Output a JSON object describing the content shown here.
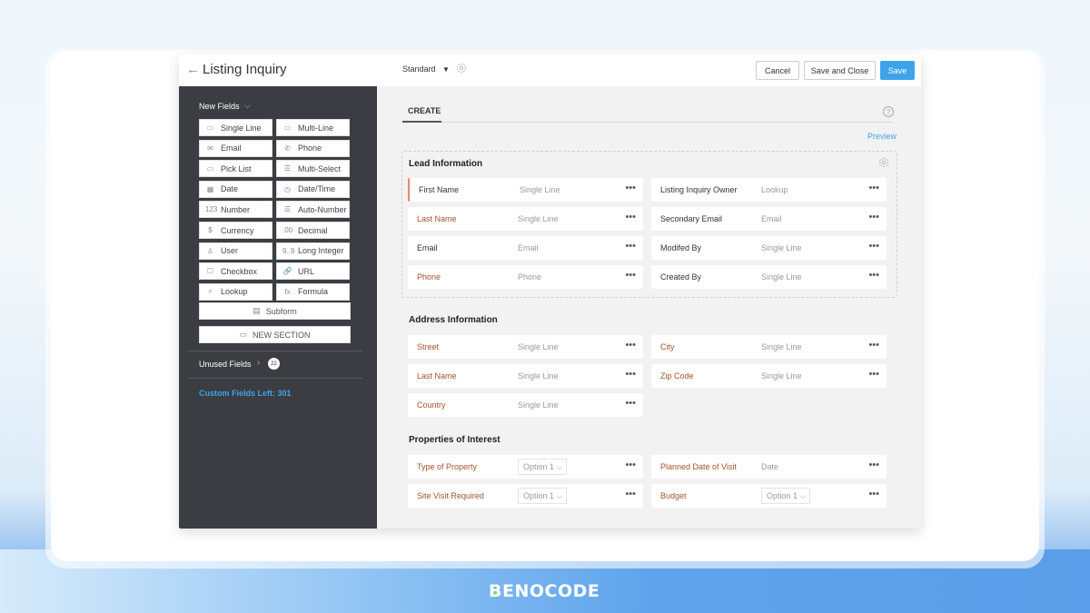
{
  "header": {
    "back_icon": "arrow-left-icon",
    "title": "Listing Inquiry",
    "layout_select": "Standard",
    "buttons": {
      "cancel": "Cancel",
      "save_close": "Save and Close",
      "save": "Save"
    }
  },
  "sidebar": {
    "new_fields_label": "New Fields",
    "fields": [
      {
        "label": "Single Line",
        "icon": "▭"
      },
      {
        "label": "Multi-Line",
        "icon": "▭"
      },
      {
        "label": "Email",
        "icon": "✉"
      },
      {
        "label": "Phone",
        "icon": "✆"
      },
      {
        "label": "Pick List",
        "icon": "▭"
      },
      {
        "label": "Multi-Select",
        "icon": "☰"
      },
      {
        "label": "Date",
        "icon": "▦"
      },
      {
        "label": "Date/Time",
        "icon": "◷"
      },
      {
        "label": "Number",
        "icon": "123"
      },
      {
        "label": "Auto-Number",
        "icon": "☰"
      },
      {
        "label": "Currency",
        "icon": "$"
      },
      {
        "label": "Decimal",
        "icon": ".00"
      },
      {
        "label": "User",
        "icon": "♙"
      },
      {
        "label": "Long Integer",
        "icon": "9..9"
      },
      {
        "label": "Checkbox",
        "icon": "☐"
      },
      {
        "label": "URL",
        "icon": "🔗"
      },
      {
        "label": "Lookup",
        "icon": "⌕"
      },
      {
        "label": "Formula",
        "icon": "fx"
      }
    ],
    "subform_label": "Subform",
    "new_section_label": "NEW SECTION",
    "unused_fields_label": "Unused Fields",
    "unused_fields_count": "22",
    "custom_fields_left": "Custom Fields Left: 301"
  },
  "main": {
    "tab": "CREATE",
    "preview_label": "Preview",
    "sections": [
      {
        "title": "Lead Information",
        "fields": [
          {
            "label": "First Name",
            "type": "Single Line",
            "required": false
          },
          {
            "label": "Listing Inquiry Owner",
            "type": "Lookup",
            "required": false
          },
          {
            "label": "Last Name",
            "type": "Single Line",
            "required": true
          },
          {
            "label": "Secondary Email",
            "type": "Email",
            "required": false
          },
          {
            "label": "Email",
            "type": "Email",
            "required": false
          },
          {
            "label": "Modifed By",
            "type": "Single Line",
            "required": false
          },
          {
            "label": "Phone",
            "type": "Phone",
            "required": true
          },
          {
            "label": "Created By",
            "type": "Single Line",
            "required": false
          }
        ]
      },
      {
        "title": "Address Information",
        "fields": [
          {
            "label": "Street",
            "type": "Single Line",
            "required": true
          },
          {
            "label": "City",
            "type": "Single Line",
            "required": true
          },
          {
            "label": "Last Name",
            "type": "Single Line",
            "required": true
          },
          {
            "label": "Zip Code",
            "type": "Single Line",
            "required": true
          },
          {
            "label": "Country",
            "type": "Single Line",
            "required": true
          }
        ]
      },
      {
        "title": "Properties of Interest",
        "fields": [
          {
            "label": "Type of Property",
            "option": "Option 1",
            "required": true
          },
          {
            "label": "Planned Date of Visit",
            "type": "Date",
            "required": true
          },
          {
            "label": "Site Visit Required",
            "option": "Option 1",
            "required": true
          },
          {
            "label": "Budget",
            "option": "Option 1",
            "required": true
          }
        ]
      }
    ],
    "more_icon": "•••"
  },
  "branding": {
    "logo": "BENOCODE"
  },
  "colors": {
    "accent": "#3fa3ec",
    "sidebar": "#3b3d42",
    "required_label": "#a0522d",
    "active_field": "#e8866a"
  }
}
